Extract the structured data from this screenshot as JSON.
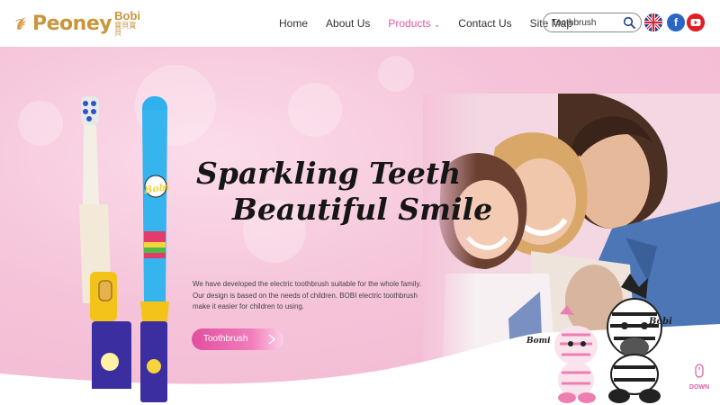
{
  "brand": {
    "name": "Peoney",
    "sub": "Bobi",
    "sub_cn": "寶貝寶貝"
  },
  "nav": {
    "items": [
      {
        "label": "Home"
      },
      {
        "label": "About Us"
      },
      {
        "label": "Products"
      },
      {
        "label": "Contact Us"
      },
      {
        "label": "Site Map"
      }
    ],
    "active": "Products"
  },
  "search": {
    "value": "Toothbrush",
    "placeholder": "Toothbrush"
  },
  "social": {
    "facebook_glyph": "f"
  },
  "hero": {
    "title_line1": "Sparkling Teeth",
    "title_line2": "Beautiful Smile",
    "description": "We have developed the electric toothbrush suitable for the whole family. Our design is based on the needs of children. BOBI electric toothbrush make it easier for children to using.",
    "cta_label": "Toothbrush",
    "brush_label": "Bobi",
    "mascot_left": "Bomi",
    "mascot_right": "Bobi",
    "down_label": "DOWN"
  },
  "colors": {
    "brand_gold": "#c8963e",
    "accent_pink": "#e05aa3",
    "hero_bg": "#f5c3d9"
  }
}
